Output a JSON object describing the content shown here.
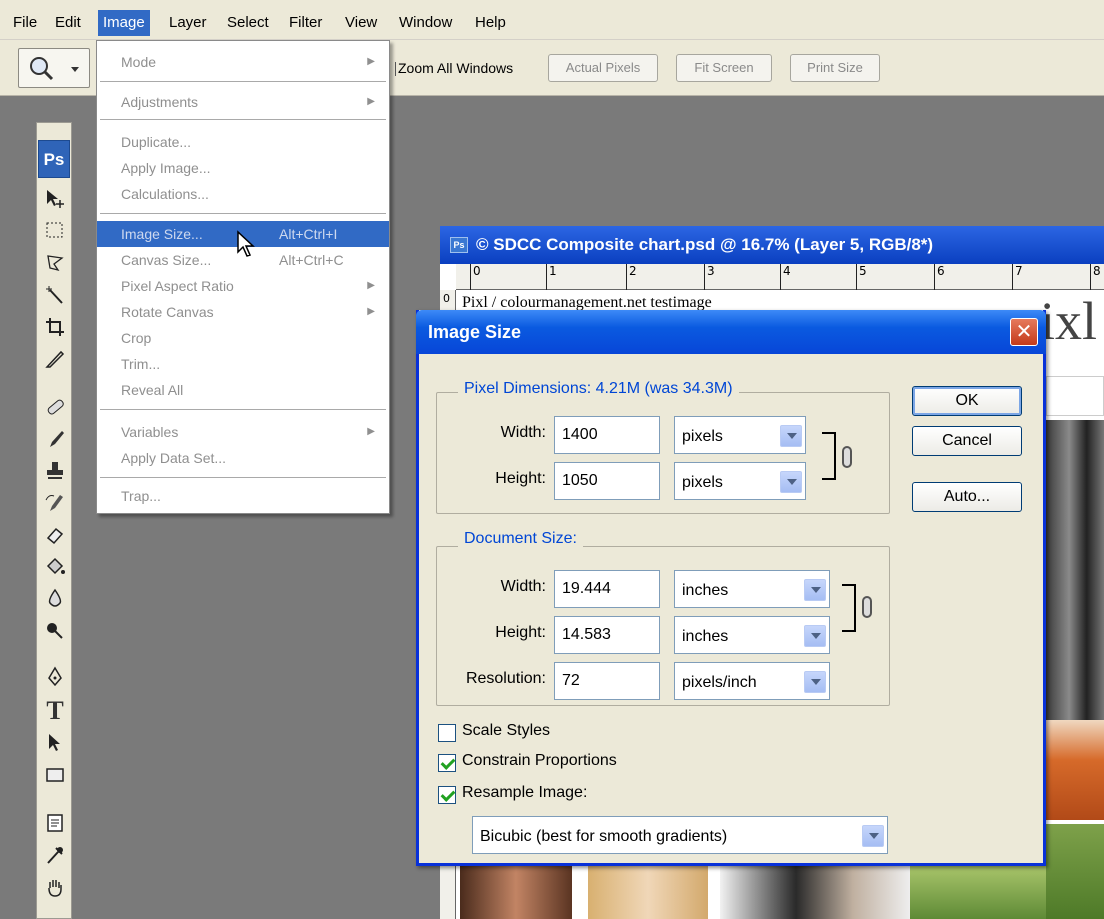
{
  "menubar": [
    "File",
    "Edit",
    "Image",
    "Layer",
    "Select",
    "Filter",
    "View",
    "Window",
    "Help"
  ],
  "options_bar": {
    "zoom_all_windows": "Zoom All Windows",
    "actual_pixels": "Actual Pixels",
    "fit_screen": "Fit Screen",
    "print_size": "Print Size"
  },
  "toolbox": {
    "badge": "Ps",
    "tools": [
      "move-tool-icon",
      "marquee-tool-icon",
      "lasso-tool-icon",
      "magic-wand-tool-icon",
      "crop-tool-icon",
      "slice-tool-icon",
      "healing-brush-tool-icon",
      "brush-tool-icon",
      "clone-stamp-tool-icon",
      "history-brush-tool-icon",
      "eraser-tool-icon",
      "paint-bucket-tool-icon",
      "blur-tool-icon",
      "dodge-tool-icon",
      "pen-tool-icon",
      "type-tool-icon",
      "path-selection-tool-icon",
      "rectangle-tool-icon",
      "notes-tool-icon",
      "eyedropper-tool-icon",
      "hand-tool-icon"
    ]
  },
  "image_menu": {
    "mode": "Mode",
    "adjustments": "Adjustments",
    "duplicate": "Duplicate...",
    "apply_image": "Apply Image...",
    "calculations": "Calculations...",
    "image_size": "Image Size...",
    "image_size_shortcut": "Alt+Ctrl+I",
    "canvas_size": "Canvas Size...",
    "canvas_size_shortcut": "Alt+Ctrl+C",
    "pixel_aspect_ratio": "Pixel Aspect Ratio",
    "rotate_canvas": "Rotate Canvas",
    "crop": "Crop",
    "trim": "Trim...",
    "reveal_all": "Reveal All",
    "variables": "Variables",
    "apply_data_set": "Apply Data Set...",
    "trap": "Trap..."
  },
  "document": {
    "title": "© SDCC Composite chart.psd @ 16.7% (Layer 5, RGB/8*)",
    "ruler_labels": [
      "0",
      "1",
      "2",
      "3",
      "4",
      "5",
      "6",
      "7",
      "8"
    ],
    "ruler_v_label": "0",
    "caption": "Pixl / colourmanagement.net testimage",
    "logo": "ixl"
  },
  "dialog": {
    "title": "Image Size",
    "close": "✕",
    "pixel_dimensions": {
      "title": "Pixel Dimensions:  4.21M (was 34.3M)",
      "width_label": "Width:",
      "width_value": "1400",
      "width_unit": "pixels",
      "height_label": "Height:",
      "height_value": "1050",
      "height_unit": "pixels"
    },
    "document_size": {
      "title": "Document Size:",
      "width_label": "Width:",
      "width_value": "19.444",
      "width_unit": "inches",
      "height_label": "Height:",
      "height_value": "14.583",
      "height_unit": "inches",
      "resolution_label": "Resolution:",
      "resolution_value": "72",
      "resolution_unit": "pixels/inch"
    },
    "scale_styles": "Scale Styles",
    "constrain_proportions": "Constrain Proportions",
    "resample_image": "Resample Image:",
    "resample_method": "Bicubic (best for smooth gradients)",
    "ok": "OK",
    "cancel": "Cancel",
    "auto": "Auto..."
  }
}
